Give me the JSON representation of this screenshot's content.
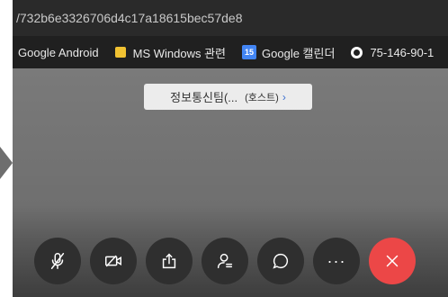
{
  "browser": {
    "url_text": "/732b6e3326706d4c17a18615bec57de8"
  },
  "bookmarks": {
    "items": [
      {
        "label": "Google Android",
        "icon": "none"
      },
      {
        "label": "MS Windows 관련",
        "icon": "folder-icon"
      },
      {
        "label": "Google 캘린더",
        "icon": "calendar-icon",
        "icon_text": "15"
      },
      {
        "label": "75-146-90-1",
        "icon": "globe-icon"
      }
    ]
  },
  "meeting": {
    "host_name": "정보통신팀(...",
    "host_role": "(호스트)",
    "host_chevron": "›"
  },
  "toolbar": {
    "buttons": [
      {
        "name": "mute-button",
        "icon": "mic-off-icon"
      },
      {
        "name": "video-button",
        "icon": "video-off-icon"
      },
      {
        "name": "share-button",
        "icon": "share-icon"
      },
      {
        "name": "participants-button",
        "icon": "participants-icon"
      },
      {
        "name": "chat-button",
        "icon": "chat-icon"
      },
      {
        "name": "more-button",
        "icon": "more-icon",
        "text": "···"
      },
      {
        "name": "end-call-button",
        "icon": "close-icon",
        "color": "#ec4747"
      }
    ]
  }
}
